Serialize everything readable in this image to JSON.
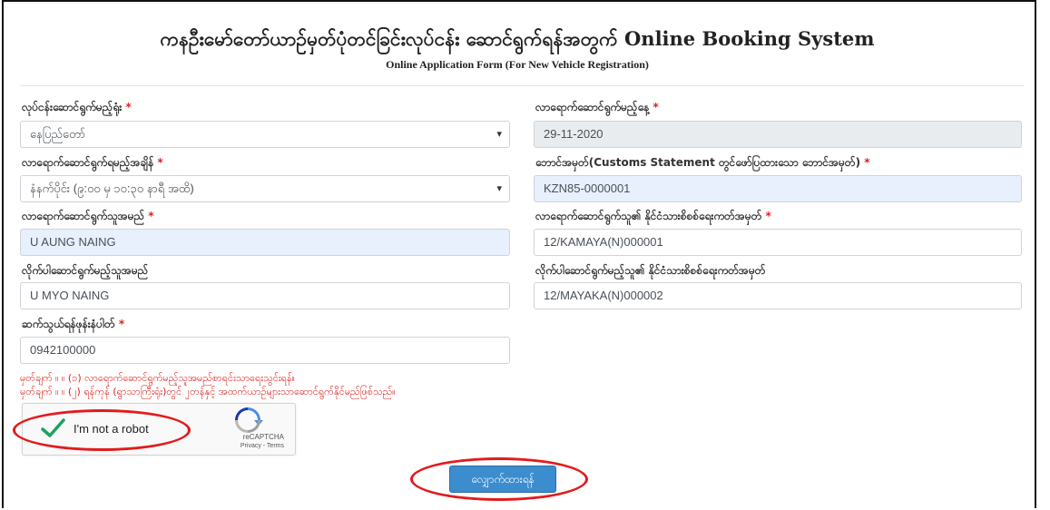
{
  "header": {
    "title": "ကနဦးမော်တော်ယာဉ်မှတ်ပုံတင်ခြင်းလုပ်ငန်း ဆောင်ရွက်ရန်အတွက် Online Booking System",
    "subtitle": "Online Application Form (For New Vehicle Registration)"
  },
  "form": {
    "required_mark": "*",
    "office": {
      "label": "လုပ်ငန်းဆောင်ရွက်မည့်ရုံး",
      "value": "နေပြည်တော်"
    },
    "date": {
      "label": "လာရောက်ဆောင်ရွက်မည့်နေ့",
      "value": "29-11-2020"
    },
    "time": {
      "label": "လာရောက်ဆောင်ရွက်ရမည့်အချိန်",
      "value": "နံနက်ပိုင်း (၉:၀၀ မှ ၁၀:၃၀ နာရီ အထိ)"
    },
    "customs_no": {
      "label": "ဘောင်အမှတ်(Customs Statement တွင်ဖော်ပြထားသော ဘောင်အမှတ်)",
      "value": "KZN85-0000001"
    },
    "applicant_name": {
      "label": "လာရောက်ဆောင်ရွက်သူအမည်",
      "value": "U AUNG NAING"
    },
    "applicant_nrc": {
      "label": "လာရောက်ဆောင်ရွက်သူ၏ နိုင်ငံသားစိစစ်ရေးကတ်အမှတ်",
      "value": "12/KAMAYA(N)000001"
    },
    "companion_name": {
      "label": "လိုက်ပါဆောင်ရွက်မည့်သူအမည်",
      "value": "U MYO NAING"
    },
    "companion_nrc": {
      "label": "လိုက်ပါဆောင်ရွက်မည့်သူ၏ နိုင်ငံသားစိစစ်ရေးကတ်အမှတ်",
      "value": "12/MAYAKA(N)000002"
    },
    "phone": {
      "label": "ဆက်သွယ်ရန်ဖုန်းနံပါတ်",
      "value": "0942100000"
    },
    "select_caret": "▾"
  },
  "notes": {
    "note1": "မှတ်ချက် ။ ။ (၁) လာရောက်ဆောင်ရွက်မည့်သူအမည်စာရင်းသာရေးသွင်းရန်။",
    "note2": "မှတ်ချက် ။ ။ (၂) ရန်ကုန် (ရွာသာကြီးရုံး)တွင် ၂တန်နှင့် အထက်ယာဉ်များသာဆောင်ရွက်နိုင်မည်ဖြစ်သည်။"
  },
  "captcha": {
    "label": "I'm not a robot",
    "brand": "reCAPTCHA",
    "links": "Privacy - Terms",
    "checked": true
  },
  "submit": {
    "label": "လျှောက်ထားရန်"
  },
  "colors": {
    "required": "#d9221e",
    "button": "#3c8dce",
    "highlight_ellipse": "#e21b1b",
    "check": "#1aa260"
  },
  "icons": {
    "check": "check-icon",
    "recaptcha": "recaptcha-logo-icon",
    "dropdown": "chevron-down-icon"
  }
}
